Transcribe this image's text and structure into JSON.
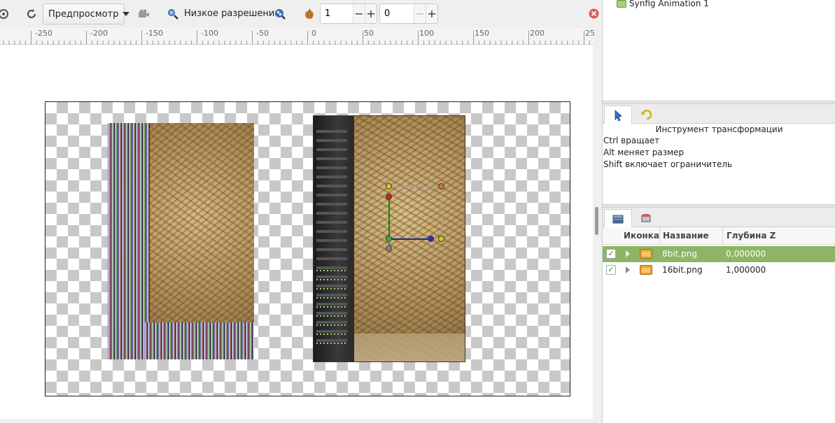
{
  "toolbar": {
    "mode_dropdown": "Предпросмотр",
    "low_res_label": "Низкое разрешение",
    "spin1_value": "1",
    "spin2_value": "0",
    "minus": "−",
    "plus": "+"
  },
  "ruler": {
    "labels": [
      "-250",
      "-200",
      "-150",
      "-100",
      "-50",
      "0",
      "50",
      "100",
      "150",
      "200",
      "25"
    ]
  },
  "canvas_browser": {
    "item": "Synfig Animation 1"
  },
  "tool_options": {
    "title": "Инструмент трансформации",
    "lines": [
      "Ctrl вращает",
      "Alt меняет размер",
      "Shift включает ограничитель"
    ]
  },
  "layers": {
    "headers": {
      "icon": "Иконка",
      "name": "Название",
      "zdepth": "Глубина Z"
    },
    "rows": [
      {
        "name": "8bit.png",
        "z": "0,000000",
        "checked": "✓",
        "selected": true
      },
      {
        "name": "16bit.png",
        "z": "1,000000",
        "checked": "✓",
        "selected": false
      }
    ]
  },
  "colors": {
    "selected_row": "#8db563",
    "handle_green": "#2bbf2b",
    "handle_yellow": "#d6c61a",
    "handle_red": "#d42020",
    "handle_blue": "#1f2fcf",
    "handle_orange": "#d9771a"
  }
}
